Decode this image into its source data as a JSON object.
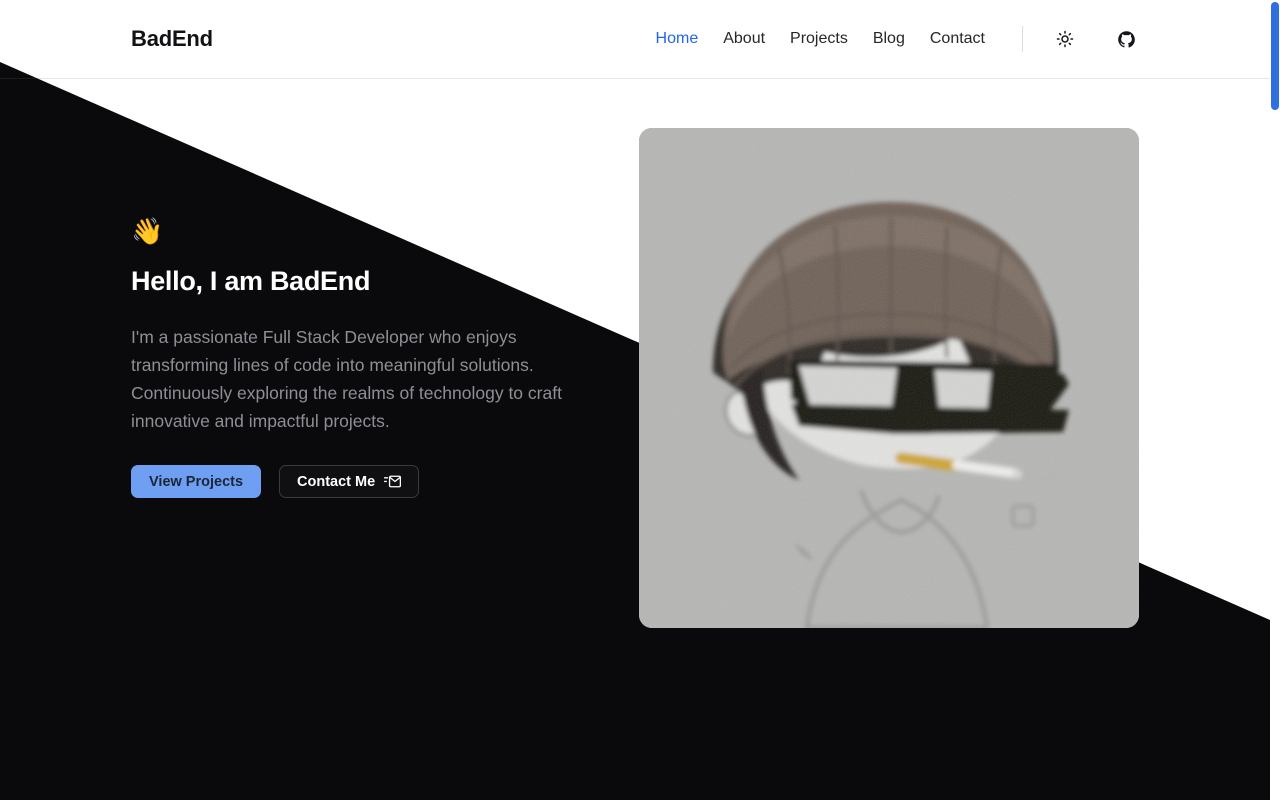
{
  "header": {
    "brand": "BadEnd",
    "nav": [
      {
        "label": "Home",
        "active": true
      },
      {
        "label": "About",
        "active": false
      },
      {
        "label": "Projects",
        "active": false
      },
      {
        "label": "Blog",
        "active": false
      },
      {
        "label": "Contact",
        "active": false
      }
    ],
    "theme_toggle_icon": "sun-icon",
    "github_icon": "github-icon"
  },
  "hero": {
    "wave_emoji": "👋",
    "title": "Hello, I am BadEnd",
    "description": "I'm a passionate Full Stack Developer who enjoys transforming lines of code into meaningful solutions. Continuously exploring the realms of technology to craft innovative and impactful projects.",
    "primary_button": "View Projects",
    "secondary_button": "Contact Me",
    "secondary_button_icon": "send-mail-icon",
    "avatar_alt": "Illustrated avatar of a person wearing a brown beanie, dark bowl-cut hair, black sunglasses and a cigarette"
  },
  "scrollbar": {
    "position": "right",
    "thumb_color": "#2f6fe0"
  },
  "colors": {
    "accent_blue": "#2563eb",
    "button_blue": "#6f9ff2",
    "dark_bg": "#0a0a0c",
    "light_bg": "#ffffff",
    "muted_text_light": "#5e5e66",
    "muted_text_dark": "#8e8e96"
  }
}
